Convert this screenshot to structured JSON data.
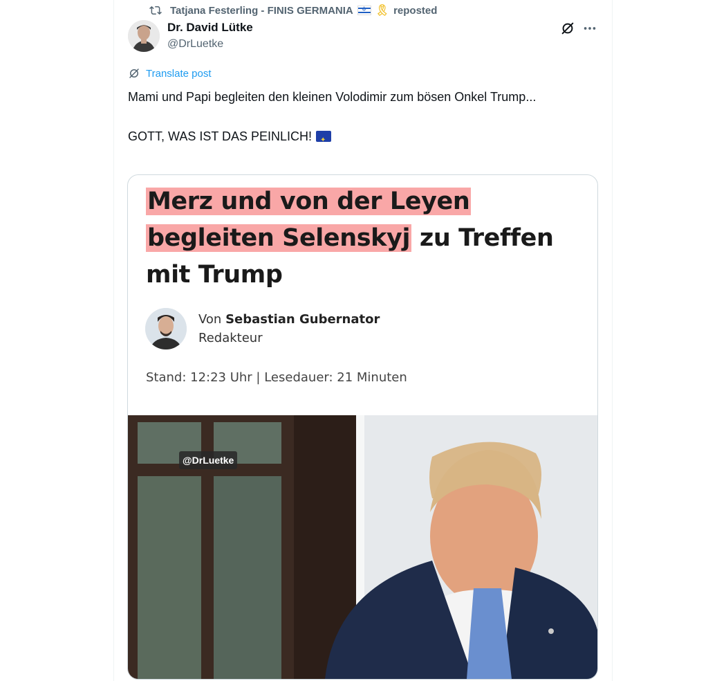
{
  "repost": {
    "user": "Tatjana Festerling - FINIS GERMANIA",
    "suffix": "reposted"
  },
  "author": {
    "name": "Dr. David Lütke",
    "handle": "@DrLuetke"
  },
  "translate_label": "Translate post",
  "post_text": {
    "line1": "Mami und Papi begleiten den kleinen Volodimir zum bösen Onkel Trump...",
    "line2": "GOTT, WAS IST DAS PEINLICH!"
  },
  "card": {
    "headline_hl1": "Merz und von der Leyen",
    "headline_hl2": "begleiten Selenskyj",
    "headline_rest1": "zu Treffen",
    "headline_rest2": "mit Trump",
    "by_prefix": "Von",
    "by_name": "Sebastian Gubernator",
    "role": "Redakteur",
    "meta": "Stand: 12:23 Uhr  |  Lesedauer: 21 Minuten",
    "watermark": "@DrLuetke"
  },
  "icons": {
    "repost": "repost-icon",
    "grok": "grok-icon",
    "more": "more-icon",
    "translate": "translate-icon"
  },
  "colors": {
    "accent": "#1d9bf0",
    "highlight": "#f9a7a7",
    "secondary_text": "#536471"
  }
}
